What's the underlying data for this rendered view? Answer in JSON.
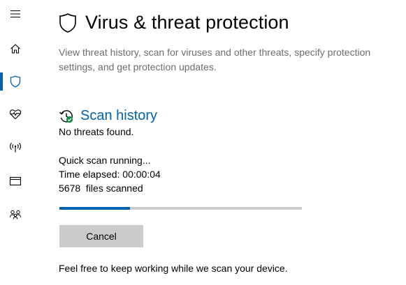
{
  "sidebar": {
    "items": [
      {
        "name": "menu",
        "icon": "hamburger-menu-icon"
      },
      {
        "name": "home",
        "icon": "home-icon"
      },
      {
        "name": "virus-threat-protection",
        "icon": "shield-icon",
        "active": true
      },
      {
        "name": "device-performance-health",
        "icon": "heart-pulse-icon"
      },
      {
        "name": "firewall-network-protection",
        "icon": "wireless-antenna-icon"
      },
      {
        "name": "app-browser-control",
        "icon": "browser-window-icon"
      },
      {
        "name": "family-options",
        "icon": "family-people-icon"
      }
    ]
  },
  "header": {
    "icon": "shield-icon",
    "title": "Virus & threat protection",
    "description": "View threat history, scan for viruses and other threats, specify protection settings, and get protection updates."
  },
  "scan_history": {
    "icon": "history-check-icon",
    "title": "Scan history",
    "status": "No threats found."
  },
  "scan": {
    "state": "Quick scan running...",
    "time_elapsed": "Time elapsed: 00:00:04",
    "files_scanned": "5678  files scanned",
    "progress_fraction": 0.29,
    "cancel_label": "Cancel",
    "footer": "Feel free to keep working while we scan your device."
  },
  "colors": {
    "accent": "#0063b1",
    "secondary_text": "#6d6d6d",
    "progress_track": "#cccccc",
    "button_bg": "#cccccc",
    "success_green": "#10893e"
  }
}
